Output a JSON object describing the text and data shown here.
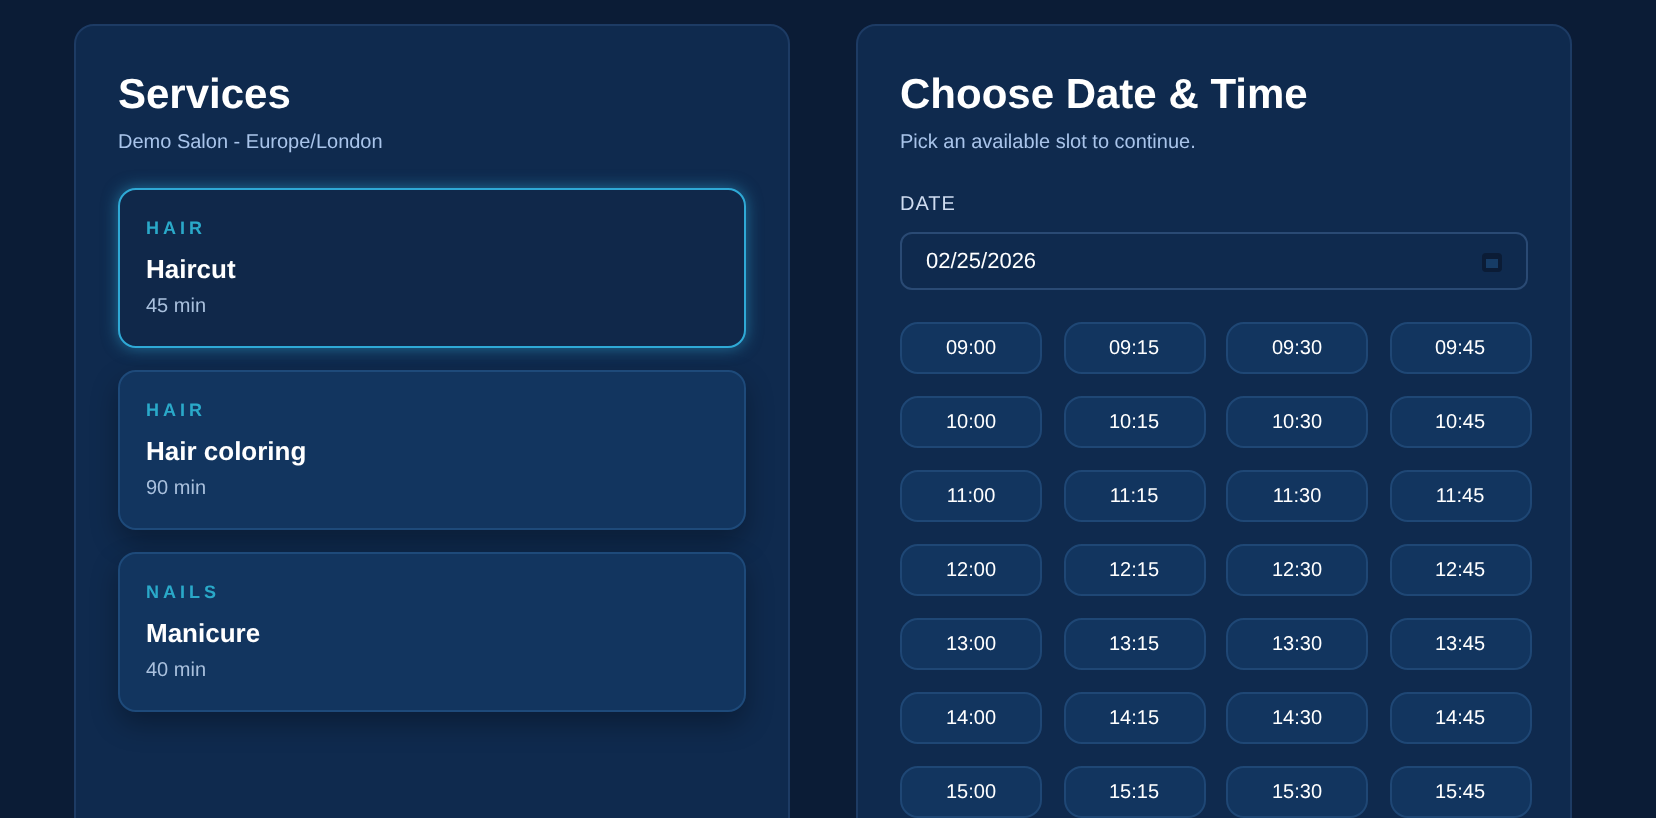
{
  "services": {
    "title": "Services",
    "subtitle": "Demo Salon - Europe/London",
    "items": [
      {
        "category": "HAIR",
        "name": "Haircut",
        "duration": "45 min",
        "selected": true
      },
      {
        "category": "HAIR",
        "name": "Hair coloring",
        "duration": "90 min",
        "selected": false
      },
      {
        "category": "NAILS",
        "name": "Manicure",
        "duration": "40 min",
        "selected": false
      }
    ]
  },
  "schedule": {
    "title": "Choose Date & Time",
    "subtitle": "Pick an available slot to continue.",
    "date_label": "DATE",
    "date_value": "02/25/2026",
    "slots": [
      "09:00",
      "09:15",
      "09:30",
      "09:45",
      "10:00",
      "10:15",
      "10:30",
      "10:45",
      "11:00",
      "11:15",
      "11:30",
      "11:45",
      "12:00",
      "12:15",
      "12:30",
      "12:45",
      "13:00",
      "13:15",
      "13:30",
      "13:45",
      "14:00",
      "14:15",
      "14:30",
      "14:45",
      "15:00",
      "15:15",
      "15:30",
      "15:45"
    ]
  }
}
